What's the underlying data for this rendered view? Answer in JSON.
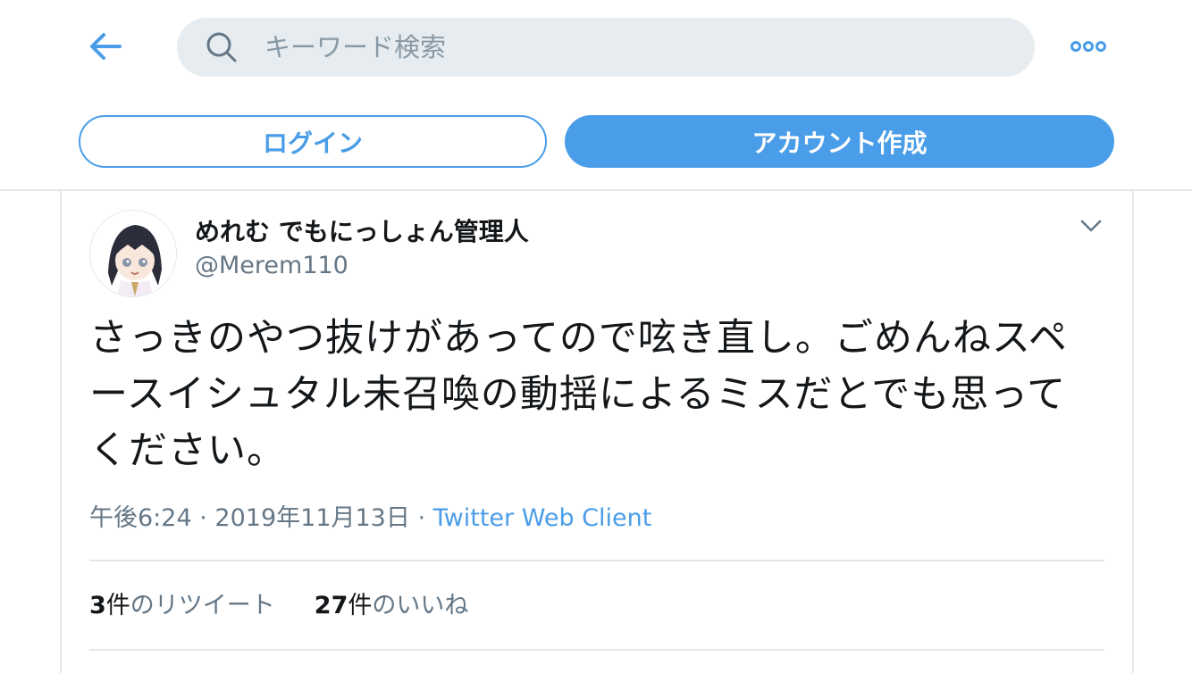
{
  "search": {
    "placeholder": "キーワード検索"
  },
  "icons": {
    "back": "arrow-left-icon",
    "search": "magnifier-icon",
    "more": "more-dots-icon",
    "chevron": "chevron-down-icon"
  },
  "auth": {
    "login_label": "ログイン",
    "signup_label": "アカウント作成"
  },
  "tweet": {
    "author": {
      "display_name": "めれむ でもにっしょん管理人",
      "handle": "@Merem110"
    },
    "text": "さっきのやつ抜けがあってので呟き直し。ごめんねスペースイシュタル未召喚の動揺によるミスだとでも思ってください。",
    "time": "午後6:24",
    "date": "2019年11月13日",
    "separator": "·",
    "client": "Twitter Web Client",
    "retweets": {
      "count": "3",
      "unit": "件",
      "label": "のリツイート"
    },
    "likes": {
      "count": "27",
      "unit": "件",
      "label": "のいいね"
    }
  },
  "colors": {
    "accent": "#4a9de8",
    "search_bg": "#e6ecf0",
    "secondary_text": "#657786",
    "divider": "#e1e8ed",
    "text": "#14171a"
  }
}
